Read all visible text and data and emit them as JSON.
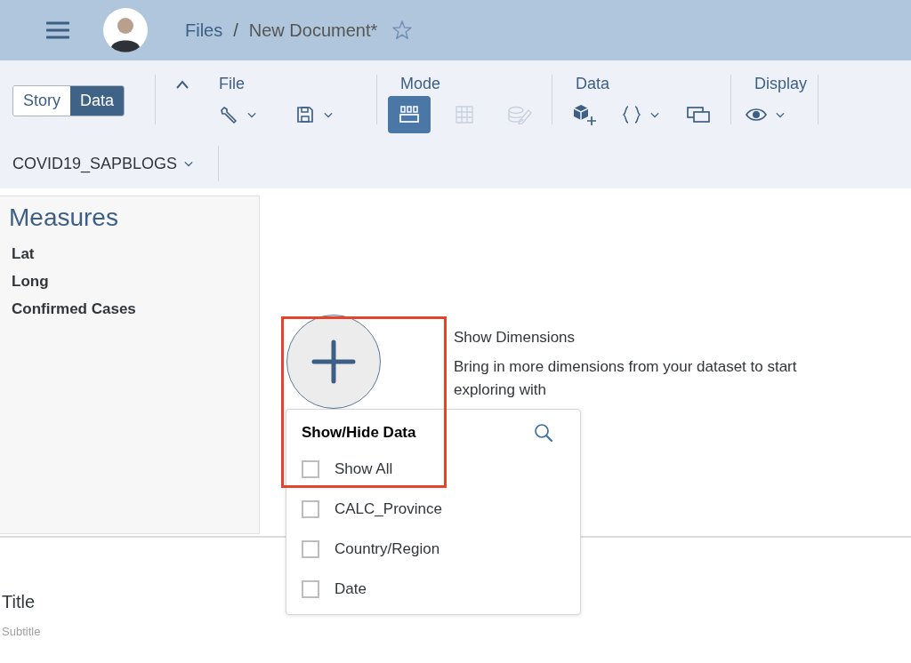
{
  "header": {
    "breadcrumb": [
      {
        "label": "Files"
      },
      {
        "label": "New Document*"
      }
    ],
    "separator": "/"
  },
  "view_toggle": [
    {
      "label": "Story",
      "selected": false
    },
    {
      "label": "Data",
      "selected": true
    }
  ],
  "toolbar_groups": [
    {
      "label": "File",
      "tools": [
        {
          "kind": "wrench",
          "dropdown": true,
          "selected": false,
          "disabled": false
        },
        {
          "kind": "save",
          "dropdown": true,
          "selected": false,
          "disabled": false
        }
      ]
    },
    {
      "label": "Mode",
      "tools": [
        {
          "kind": "layout",
          "dropdown": false,
          "selected": true,
          "disabled": false
        },
        {
          "kind": "table",
          "dropdown": false,
          "selected": false,
          "disabled": true
        },
        {
          "kind": "data-edit",
          "dropdown": false,
          "selected": false,
          "disabled": true
        }
      ]
    },
    {
      "label": "Data",
      "tools": [
        {
          "kind": "cubes-add",
          "dropdown": false,
          "selected": false,
          "disabled": false
        },
        {
          "kind": "braces",
          "dropdown": true,
          "selected": false,
          "disabled": false
        },
        {
          "kind": "windows",
          "dropdown": false,
          "selected": false,
          "disabled": false
        }
      ]
    },
    {
      "label": "Display",
      "tools": [
        {
          "kind": "eye",
          "dropdown": true,
          "selected": false,
          "disabled": false
        }
      ]
    }
  ],
  "dataset": "COVID19_SAPBLOGS",
  "measures": {
    "title": "Measures",
    "items": [
      "Lat",
      "Long",
      "Confirmed Cases"
    ]
  },
  "empty_state": {
    "heading": "Show Dimensions",
    "text": "Bring in more dimensions from your dataset to start exploring with"
  },
  "popup": {
    "title": "Show/Hide Data",
    "items": [
      {
        "label": "Show All",
        "checked": false
      },
      {
        "label": "CALC_Province",
        "checked": false
      },
      {
        "label": "Country/Region",
        "checked": false
      },
      {
        "label": "Date",
        "checked": false
      }
    ]
  },
  "chart_header": {
    "title": "Title",
    "subtitle": "Subtitle"
  }
}
